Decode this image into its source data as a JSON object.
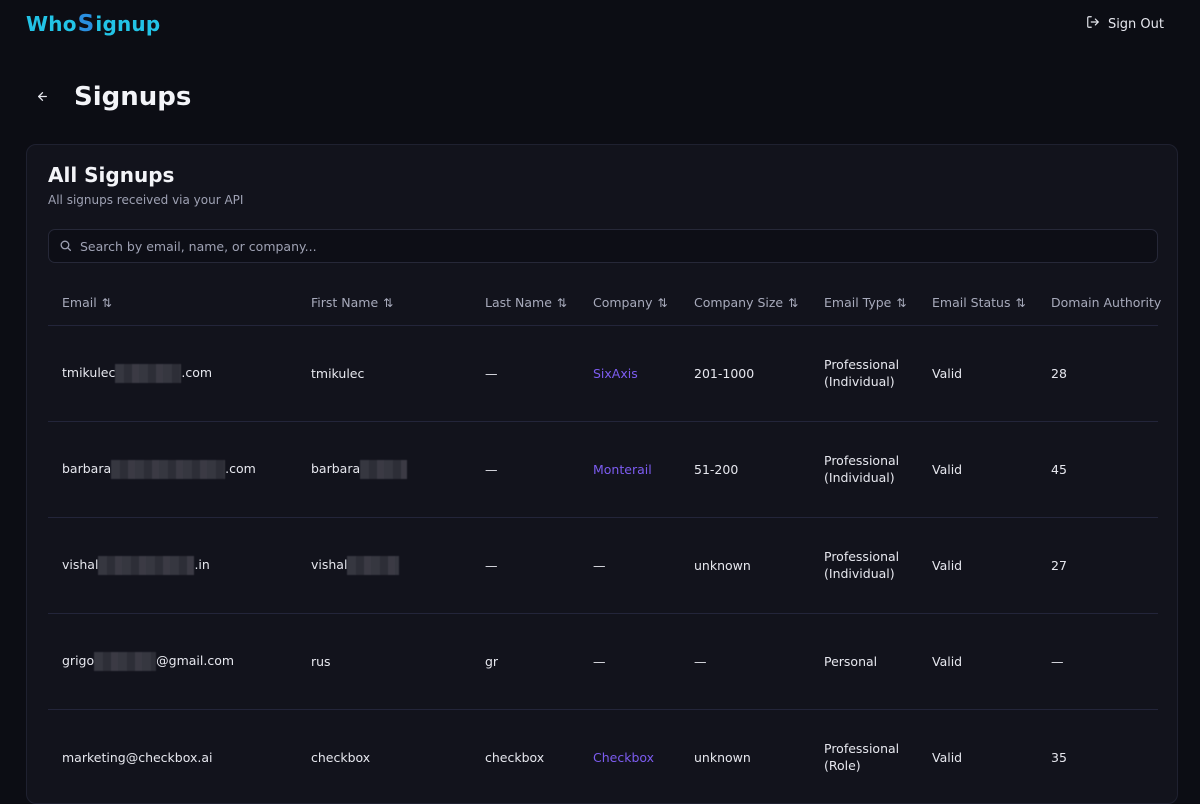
{
  "app": {
    "logo_pre": "Who",
    "logo_s": "S",
    "logo_post": "ignup",
    "signout_label": "Sign Out"
  },
  "page": {
    "title": "Signups"
  },
  "card": {
    "title": "All Signups",
    "subtitle": "All signups received via your API",
    "search_placeholder": "Search by email, name, or company..."
  },
  "columns": [
    "Email",
    "First Name",
    "Last Name",
    "Company",
    "Company Size",
    "Email Type",
    "Email Status",
    "Domain Authority"
  ],
  "rows": [
    {
      "email_pre": "tmikulec",
      "email_post": ".com",
      "first": "tmikulec",
      "last": "—",
      "company": "SixAxis",
      "size": "201-1000",
      "type": "Professional (Individual)",
      "status": "Valid",
      "authority": "28"
    },
    {
      "email_pre": "barbara",
      "email_post": ".com",
      "first": "barbara",
      "last": "—",
      "company": "Monterail",
      "size": "51-200",
      "type": "Professional (Individual)",
      "status": "Valid",
      "authority": "45"
    },
    {
      "email_pre": "vishal",
      "email_post": ".in",
      "first": "vishal",
      "last": "—",
      "company": "—",
      "size": "unknown",
      "type": "Professional (Individual)",
      "status": "Valid",
      "authority": "27"
    },
    {
      "email_pre": "grigo",
      "email_post": "@gmail.com",
      "first": "rus",
      "last": "gr",
      "company": "—",
      "size": "—",
      "type": "Personal",
      "status": "Valid",
      "authority": "—"
    },
    {
      "email_pre": "marketing@checkbox.ai",
      "email_post": "",
      "first": "checkbox",
      "last": "checkbox",
      "company": "Checkbox",
      "size": "unknown",
      "type": "Professional (Role)",
      "status": "Valid",
      "authority": "35"
    }
  ],
  "colors": {
    "accent_link": "#7c5cf0",
    "logo": "#22c3e6",
    "background": "#0c0d14",
    "card": "#12131c"
  }
}
